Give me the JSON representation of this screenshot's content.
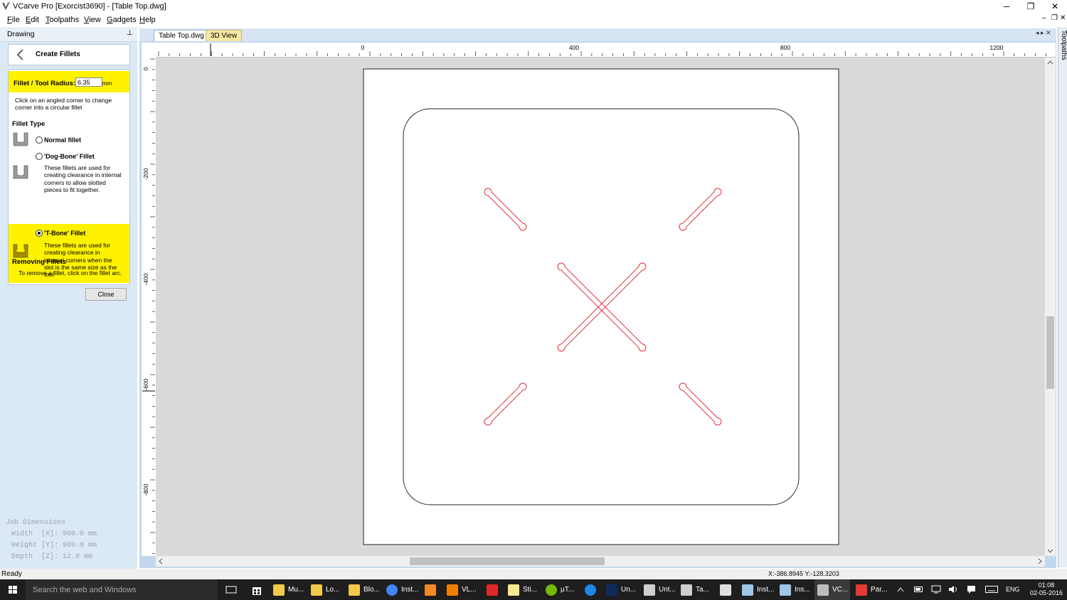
{
  "window": {
    "title": "VCarve Pro [Exorcist3690] - [Table Top.dwg]",
    "minimize": "─",
    "restore": "❐",
    "close": "✕"
  },
  "menu": [
    "File",
    "Edit",
    "Toolpaths",
    "View",
    "Gadgets",
    "Help"
  ],
  "mdi": {
    "min": "‒",
    "restore": "❐",
    "close": "✕"
  },
  "panel": {
    "header": "Drawing",
    "pin": "📌",
    "title": "Create Fillets",
    "radius_label": "Fillet / Tool Radius:",
    "radius_value": "6.35",
    "radius_unit": "mm",
    "instructions": [
      "Click on an angled corner to change",
      "corner into a circular fillet"
    ],
    "fillet_type_heading": "Fillet Type",
    "options": [
      {
        "label": "Normal fillet",
        "selected": false,
        "desc": []
      },
      {
        "label": "'Dog-Bone' Fillet",
        "selected": false,
        "desc": [
          "These fillets are used for",
          "creating clearance in internal",
          "corners to allow slotted",
          "pieces to fit together."
        ]
      },
      {
        "label": "'T-Bone' Fillet",
        "selected": true,
        "desc": [
          "These fillets are used for",
          "creating clearance in",
          "internal corners when the",
          "slot is the same size as the",
          "tool"
        ]
      }
    ],
    "removing_heading": "Removing Fillets",
    "removing_text": "To remove a fillet, click on the fillet arc.",
    "close_label": "Close",
    "job_dimensions": {
      "heading": "Job Dimensions",
      "width": "Width  [X]: 900.0 mm",
      "height": "Height [Y]: 900.0 mm",
      "depth": "Depth  [Z]: 12.0 mm"
    }
  },
  "tabs": [
    {
      "label": "Table Top.dwg",
      "active": true
    },
    {
      "label": "3D View",
      "active": false
    }
  ],
  "tabnav": "◂ ▸ ✕",
  "ruler": {
    "top_labels": [
      "0",
      "400",
      "800",
      "1200"
    ],
    "left_labels": [
      "0",
      "-200",
      "-400",
      "-600",
      "-800"
    ]
  },
  "right_tab": "Toolpaths",
  "status": {
    "text": "Ready",
    "coords": "X:-386.8945 Y:-128.3203"
  },
  "taskbar": {
    "search": "Search the web and Windows",
    "items": [
      {
        "label": "Mu...",
        "icon": "folder-icon"
      },
      {
        "label": "Lo...",
        "icon": "folder-icon"
      },
      {
        "label": "Blo...",
        "icon": "folder-icon"
      },
      {
        "label": "Inst...",
        "icon": "chrome-icon"
      },
      {
        "label": "",
        "icon": "media-player-icon"
      },
      {
        "label": "VL...",
        "icon": "vlc-icon"
      },
      {
        "label": "",
        "icon": "flipboard-icon"
      },
      {
        "label": "Sti...",
        "icon": "sticky-icon"
      },
      {
        "label": "µT...",
        "icon": "utorrent-icon"
      },
      {
        "label": "",
        "icon": "edge-icon"
      },
      {
        "label": "Un...",
        "icon": "photoshop-icon"
      },
      {
        "label": "Unt...",
        "icon": "app-icon"
      },
      {
        "label": "Ta...",
        "icon": "app-icon"
      },
      {
        "label": "",
        "icon": "calculator-icon"
      },
      {
        "label": "Inst...",
        "icon": "document-icon"
      },
      {
        "label": "Ins...",
        "icon": "document-icon"
      },
      {
        "label": "VC...",
        "icon": "vcarve-icon"
      },
      {
        "label": "Par...",
        "icon": "paint-icon"
      }
    ],
    "language": "ENG",
    "time": "01:08",
    "date": "02-05-2016"
  },
  "colors": {
    "accent_yellow": "#fff200",
    "toolpath_red": "#e0303a",
    "panel_bg": "#dbe8f5",
    "tab_3d": "#f6e6a3"
  }
}
